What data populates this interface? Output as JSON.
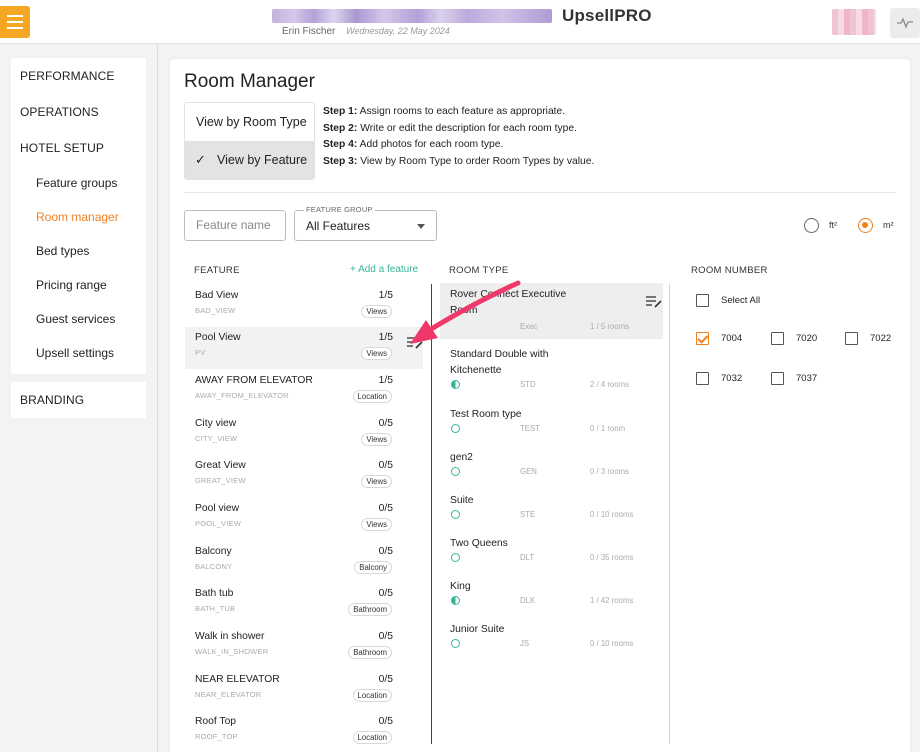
{
  "header": {
    "app_name": "UpsellPRO",
    "user_name": "Erin Fischer",
    "date": "Wednesday, 22 May 2024"
  },
  "sidebar": {
    "top": [
      "PERFORMANCE",
      "OPERATIONS"
    ],
    "hotel_setup": {
      "label": "HOTEL SETUP",
      "items": [
        "Feature groups",
        "Room manager",
        "Bed types",
        "Pricing range",
        "Guest services",
        "Upsell settings"
      ],
      "active": "Room manager"
    },
    "branding": "BRANDING"
  },
  "page": {
    "title": "Room Manager",
    "view_by_room_type": "View by Room Type",
    "view_by_feature": "View by Feature",
    "steps": [
      {
        "label": "Step 1:",
        "text": " Assign rooms to each feature as appropriate."
      },
      {
        "label": "Step 2:",
        "text": " Write or edit the description for each room type."
      },
      {
        "label": "Step 4:",
        "text": " Add photos for each room type."
      },
      {
        "label": "Step 3:",
        "text": " View by Room Type to order Room Types by value."
      }
    ],
    "feature_name_placeholder": "Feature name",
    "feature_group_legend": "FEATURE GROUP",
    "feature_group_value": "All Features",
    "unit_ft": "ft²",
    "unit_m": "m²",
    "selected_unit": "m²"
  },
  "columns": {
    "feature": "FEATURE",
    "add_feature": "+ Add a feature",
    "room_type": "ROOM TYPE",
    "room_number": "ROOM NUMBER"
  },
  "features": [
    {
      "name": "Bad View",
      "code": "BAD_VIEW",
      "count": "1/5",
      "group": "Views"
    },
    {
      "name": "Pool View",
      "code": "PV",
      "count": "1/5",
      "group": "Views"
    },
    {
      "name": "AWAY FROM ELEVATOR",
      "code": "AWAY_FROM_ELEVATOR",
      "count": "1/5",
      "group": "Location"
    },
    {
      "name": "City view",
      "code": "CITY_VIEW",
      "count": "0/5",
      "group": "Views"
    },
    {
      "name": "Great View",
      "code": "GREAT_VIEW",
      "count": "0/5",
      "group": "Views"
    },
    {
      "name": "Pool view",
      "code": "POOL_VIEW",
      "count": "0/5",
      "group": "Views"
    },
    {
      "name": "Balcony",
      "code": "BALCONY",
      "count": "0/5",
      "group": "Balcony"
    },
    {
      "name": "Bath tub",
      "code": "BATH_TUB",
      "count": "0/5",
      "group": "Bathroom"
    },
    {
      "name": "Walk in shower",
      "code": "WALK_IN_SHOWER",
      "count": "0/5",
      "group": "Bathroom"
    },
    {
      "name": "NEAR ELEVATOR",
      "code": "NEAR_ELEVATOR",
      "count": "0/5",
      "group": "Location"
    },
    {
      "name": "Roof Top",
      "code": "ROOF_TOP",
      "count": "0/5",
      "group": "Location"
    }
  ],
  "room_types": [
    {
      "name": "Rover Connect Executive Room",
      "code": "Exec",
      "rooms": "1 / 5 rooms"
    },
    {
      "name": "Standard Double with Kitchenette",
      "code": "STD",
      "rooms": "2 / 4 rooms"
    },
    {
      "name": "Test Room type",
      "code": "TEST",
      "rooms": "0 / 1 room"
    },
    {
      "name": "gen2",
      "code": "GEN",
      "rooms": "0 / 3 rooms"
    },
    {
      "name": "Suite",
      "code": "STE",
      "rooms": "0 / 10 rooms"
    },
    {
      "name": "Two Queens",
      "code": "DLT",
      "rooms": "0 / 35 rooms"
    },
    {
      "name": "King",
      "code": "DLK",
      "rooms": "1 / 42 rooms"
    },
    {
      "name": "Junior Suite",
      "code": "JS",
      "rooms": "0 / 10 rooms"
    }
  ],
  "room_numbers": {
    "select_all": "Select All",
    "rooms": [
      {
        "number": "7004",
        "checked": true
      },
      {
        "number": "7020",
        "checked": false
      },
      {
        "number": "7022",
        "checked": false
      },
      {
        "number": "7032",
        "checked": false
      },
      {
        "number": "7037",
        "checked": false
      }
    ]
  },
  "colors": {
    "accent": "#f07f1e",
    "teal": "#36b59a",
    "annotation_arrow": "#f0386b"
  }
}
